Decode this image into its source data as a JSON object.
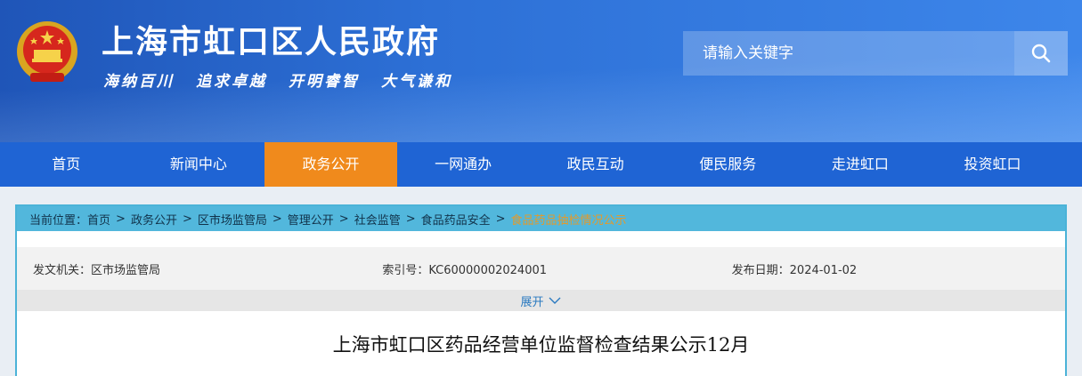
{
  "header": {
    "site_title": "上海市虹口区人民政府",
    "slogans": [
      "海纳百川",
      "追求卓越",
      "开明睿智",
      "大气谦和"
    ],
    "search_placeholder": "请输入关键字",
    "brand_color": "#2d70d6"
  },
  "nav": {
    "items": [
      "首页",
      "新闻中心",
      "政务公开",
      "一网通办",
      "政民互动",
      "便民服务",
      "走进虹口",
      "投资虹口"
    ],
    "active_index": 2,
    "active_color": "#f08a1c"
  },
  "breadcrumb": {
    "prefix": "当前位置：",
    "items": [
      "首页",
      "政务公开",
      "区市场监管局",
      "管理公开",
      "社会监管",
      "食品药品安全"
    ],
    "current": "食品药品抽检情况公示",
    "separator": ">"
  },
  "meta": {
    "issuer": "发文机关：区市场监管局",
    "index_no": "索引号：KC60000002024001",
    "date": "发布日期：2024-01-02"
  },
  "expand_label": "展开",
  "document": {
    "title": "上海市虹口区药品经营单位监督检查结果公示12月"
  }
}
